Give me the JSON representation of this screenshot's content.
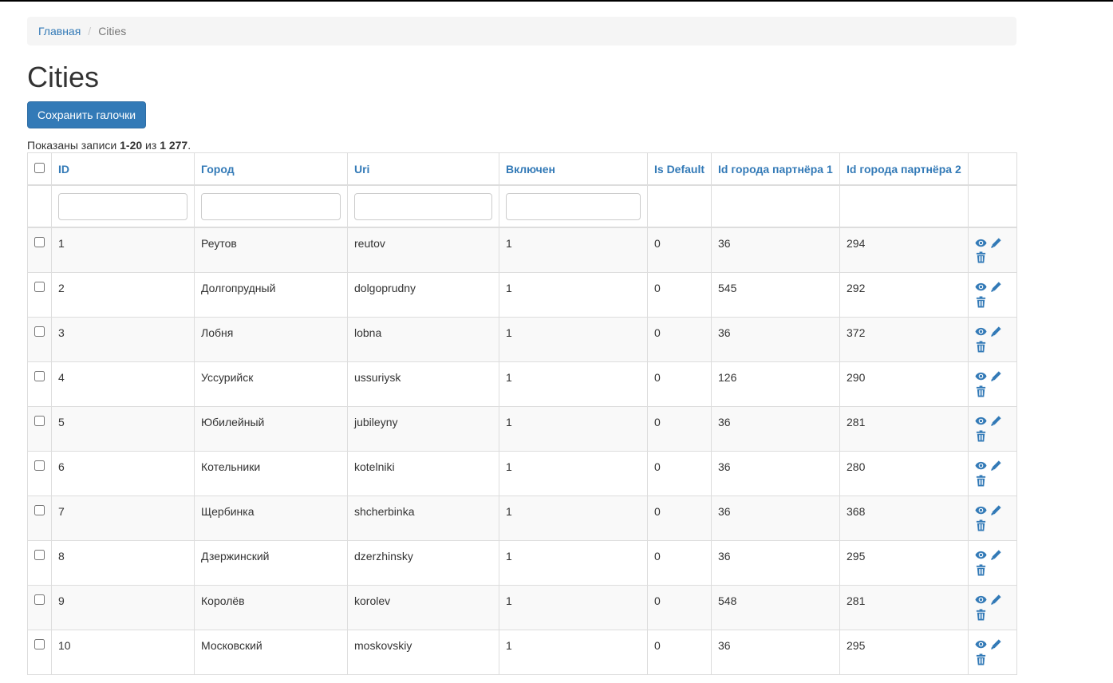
{
  "breadcrumb": {
    "home": "Главная",
    "current": "Cities"
  },
  "page": {
    "title": "Cities",
    "save_button": "Сохранить галочки",
    "summary": {
      "prefix": "Показаны записи ",
      "range": "1-20",
      "middle": " из ",
      "total": "1 277",
      "suffix": "."
    }
  },
  "table": {
    "columns": [
      "ID",
      "Город",
      "Uri",
      "Включен",
      "Is Default",
      "Id города партнёра 1",
      "Id города партнёра 2"
    ],
    "rows": [
      {
        "id": "1",
        "city": "Реутов",
        "uri": "reutov",
        "enabled": "1",
        "is_default": "0",
        "p1": "36",
        "p2": "294"
      },
      {
        "id": "2",
        "city": "Долгопрудный",
        "uri": "dolgoprudny",
        "enabled": "1",
        "is_default": "0",
        "p1": "545",
        "p2": "292"
      },
      {
        "id": "3",
        "city": "Лобня",
        "uri": "lobna",
        "enabled": "1",
        "is_default": "0",
        "p1": "36",
        "p2": "372"
      },
      {
        "id": "4",
        "city": "Уссурийск",
        "uri": "ussuriysk",
        "enabled": "1",
        "is_default": "0",
        "p1": "126",
        "p2": "290"
      },
      {
        "id": "5",
        "city": "Юбилейный",
        "uri": "jubileyny",
        "enabled": "1",
        "is_default": "0",
        "p1": "36",
        "p2": "281"
      },
      {
        "id": "6",
        "city": "Котельники",
        "uri": "kotelniki",
        "enabled": "1",
        "is_default": "0",
        "p1": "36",
        "p2": "280"
      },
      {
        "id": "7",
        "city": "Щербинка",
        "uri": "shcherbinka",
        "enabled": "1",
        "is_default": "0",
        "p1": "36",
        "p2": "368"
      },
      {
        "id": "8",
        "city": "Дзержинский",
        "uri": "dzerzhinsky",
        "enabled": "1",
        "is_default": "0",
        "p1": "36",
        "p2": "295"
      },
      {
        "id": "9",
        "city": "Королёв",
        "uri": "korolev",
        "enabled": "1",
        "is_default": "0",
        "p1": "548",
        "p2": "281"
      },
      {
        "id": "10",
        "city": "Московский",
        "uri": "moskovskiy",
        "enabled": "1",
        "is_default": "0",
        "p1": "36",
        "p2": "295"
      }
    ]
  },
  "icons": {
    "view": "eye-icon",
    "edit": "pencil-icon",
    "delete": "trash-icon"
  },
  "colors": {
    "accent": "#337ab7",
    "border": "#dddddd",
    "stripe": "#f9f9f9"
  }
}
